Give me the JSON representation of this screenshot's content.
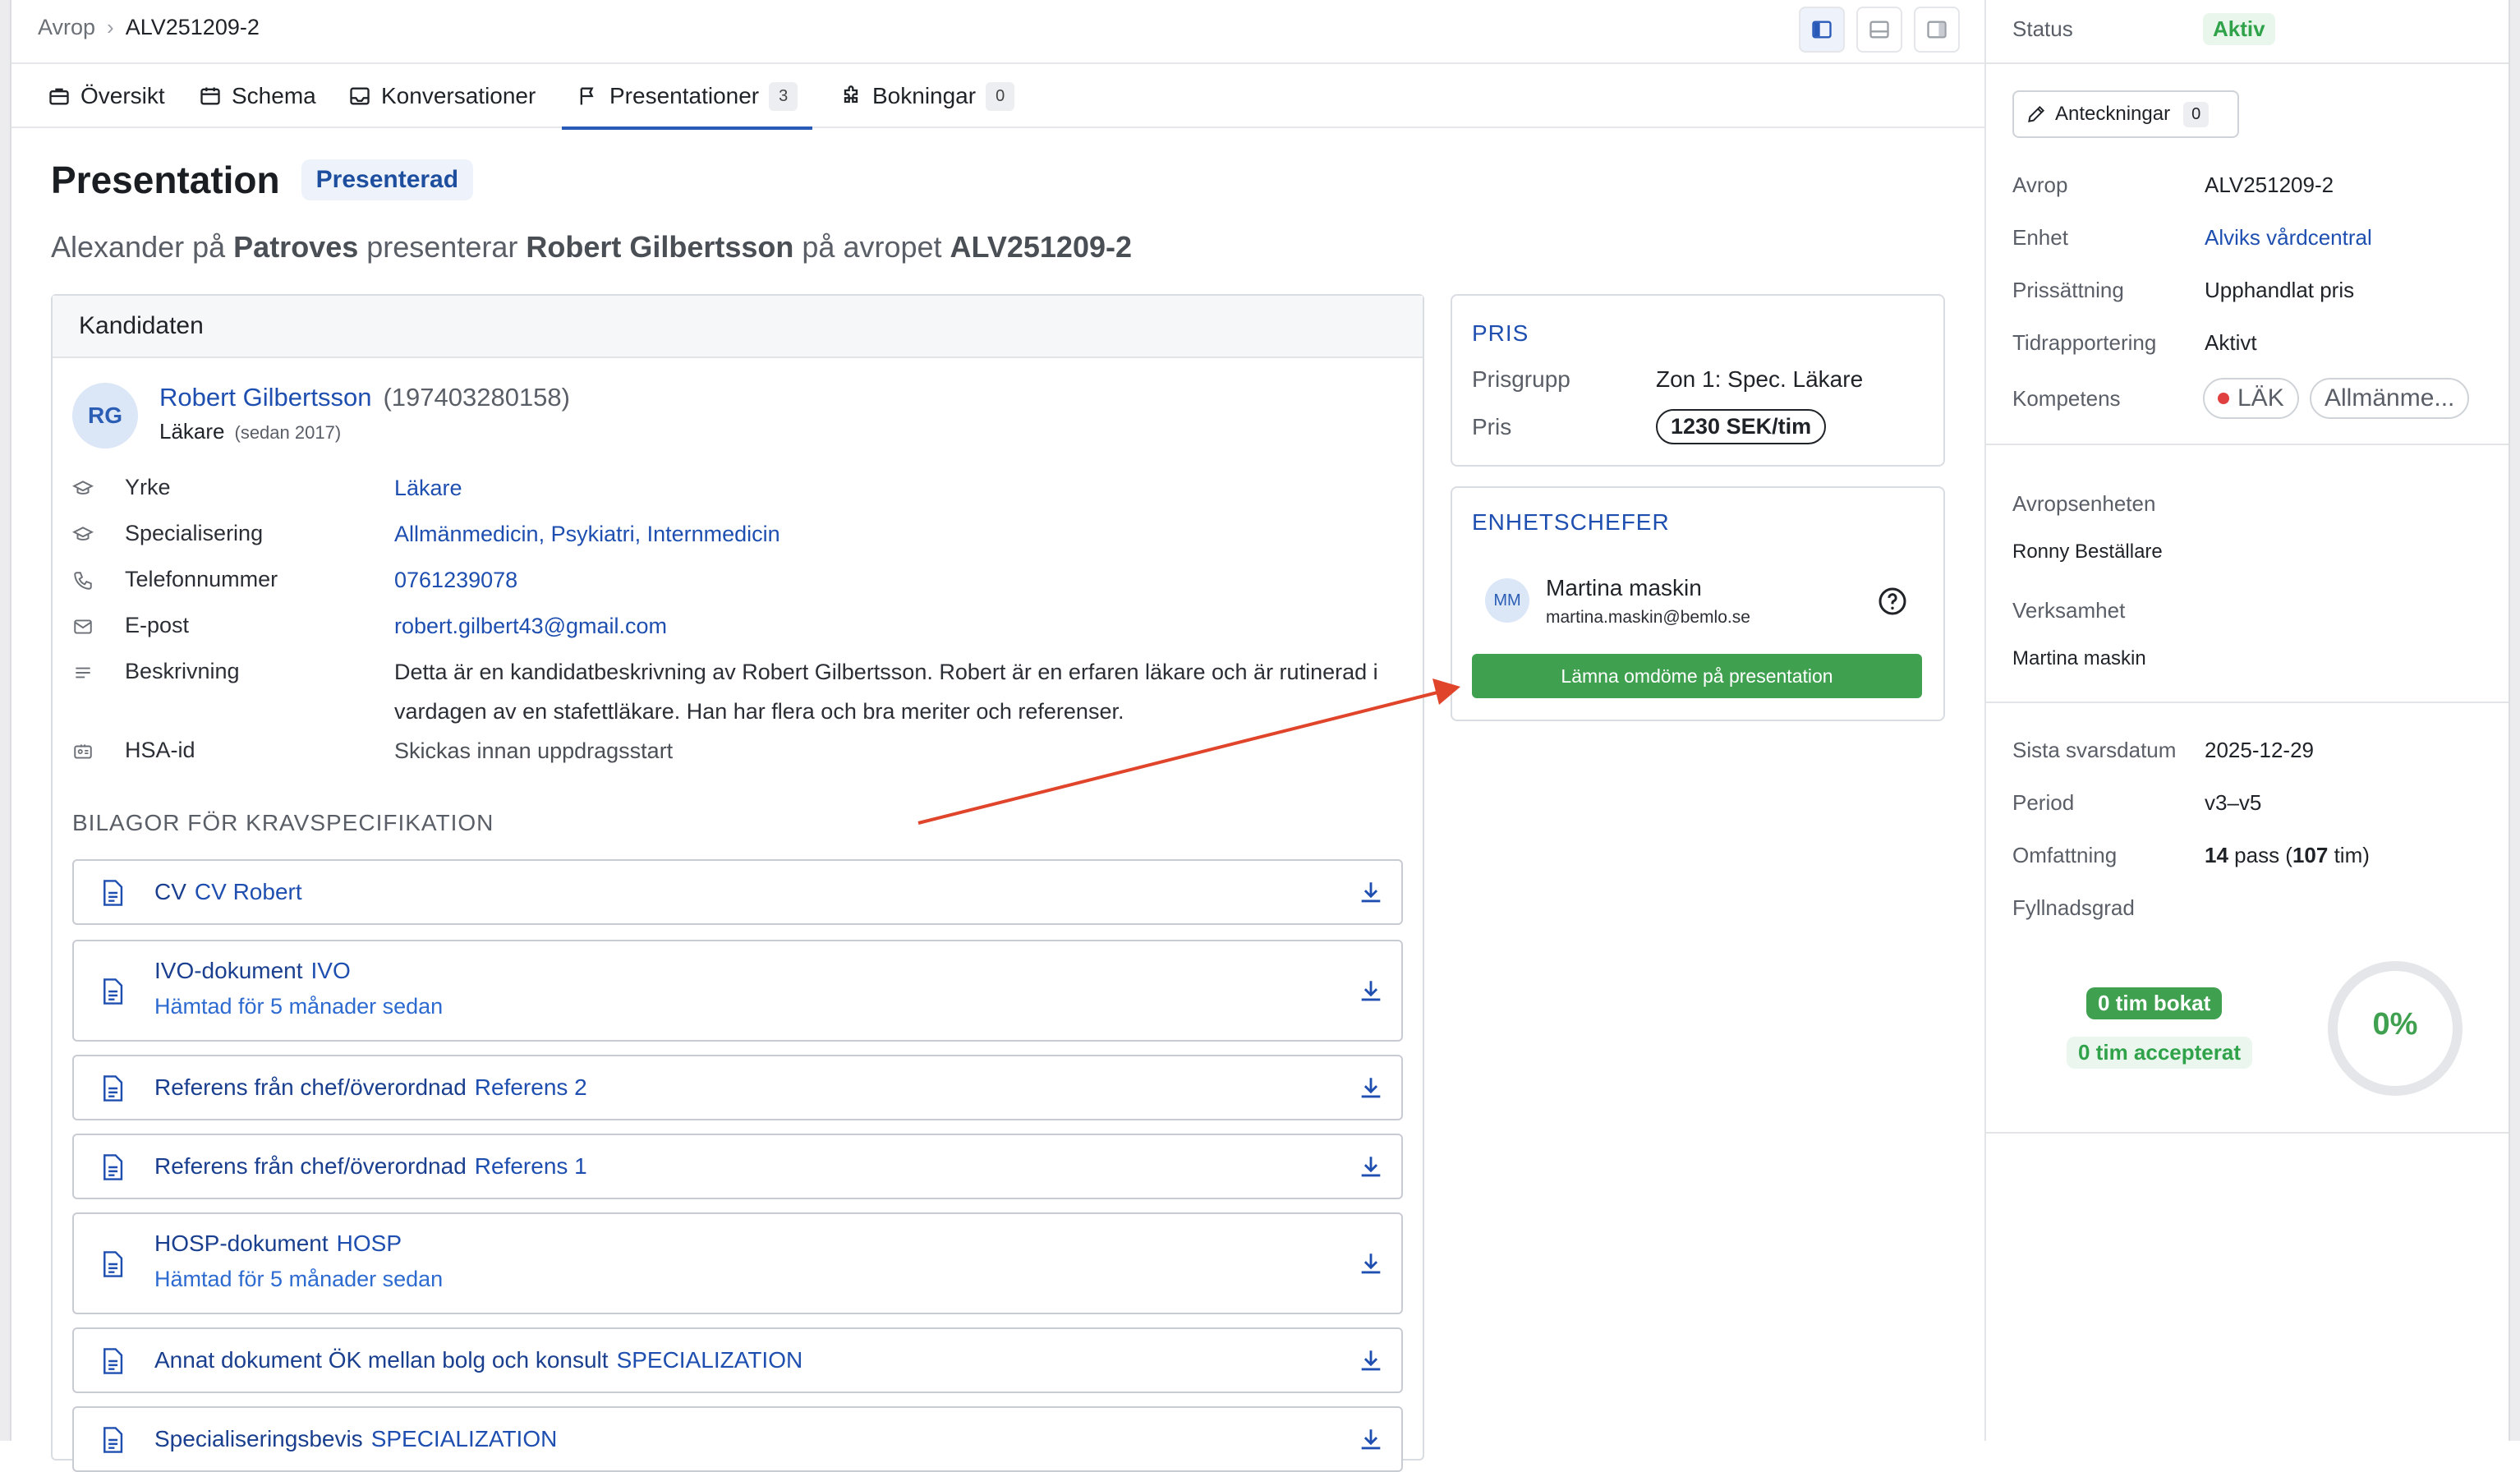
{
  "breadcrumb": {
    "root": "Avrop",
    "current": "ALV251209-2"
  },
  "tabs": [
    {
      "label": "Översikt",
      "icon": "briefcase-icon"
    },
    {
      "label": "Schema",
      "icon": "calendar-icon"
    },
    {
      "label": "Konversationer",
      "icon": "inbox-icon"
    },
    {
      "label": "Presentationer",
      "icon": "flag-icon",
      "count": "3",
      "active": true
    },
    {
      "label": "Bokningar",
      "icon": "puzzle-icon",
      "count": "0"
    }
  ],
  "header": {
    "title": "Presentation",
    "status": "Presenterad",
    "subtitle": {
      "person": "Alexander",
      "p1": " på ",
      "org": "Patroves",
      "p2": " presenterar ",
      "candidate": "Robert Gilbertsson",
      "p3": " på avropet ",
      "ref": "ALV251209-2"
    }
  },
  "candidate": {
    "section_title": "Kandidaten",
    "initials": "RG",
    "name": "Robert Gilbertsson",
    "personal_number": "(197403280158)",
    "role": "Läkare",
    "since": "(sedan 2017)",
    "fields": [
      {
        "label": "Yrke",
        "value": "Läkare",
        "icon": "graduation-cap-icon"
      },
      {
        "label": "Specialisering",
        "value": "Allmänmedicin, Psykiatri, Internmedicin",
        "icon": "graduation-cap-icon"
      },
      {
        "label": "Telefonnummer",
        "value": "0761239078",
        "icon": "phone-icon"
      },
      {
        "label": "E-post",
        "value": "robert.gilbert43@gmail.com",
        "icon": "mail-icon"
      },
      {
        "label": "Beskrivning",
        "value": "Detta är en kandidatbeskrivning av Robert Gilbertsson. Robert är en erfaren läkare och är rutinerad i vardagen av en stafettläkare. Han har flera och bra meriter och referenser.",
        "icon": "lines-icon"
      },
      {
        "label": "HSA-id",
        "value": "Skickas innan uppdragsstart",
        "icon": "id-card-icon"
      }
    ],
    "attachments_title": "BILAGOR FÖR KRAVSPECIFIKATION",
    "attachments": [
      {
        "type": "CV",
        "name": "CV Robert",
        "fetched": ""
      },
      {
        "type": "IVO-dokument",
        "name": "IVO",
        "fetched": "Hämtad för 5 månader sedan"
      },
      {
        "type": "Referens från chef/överordnad",
        "name": "Referens 2",
        "fetched": ""
      },
      {
        "type": "Referens från chef/överordnad",
        "name": "Referens 1",
        "fetched": ""
      },
      {
        "type": "HOSP-dokument",
        "name": "HOSP",
        "fetched": "Hämtad för 5 månader sedan"
      },
      {
        "type": "Annat dokument ÖK mellan bolg och konsult",
        "name": "SPECIALIZATION",
        "fetched": ""
      },
      {
        "type": "Specialiseringsbevis",
        "name": "SPECIALIZATION",
        "fetched": ""
      }
    ]
  },
  "price": {
    "title": "PRIS",
    "group_label": "Prisgrupp",
    "group_value": "Zon 1: Spec. Läkare",
    "price_label": "Pris",
    "price_value": "1230 SEK/tim"
  },
  "managers": {
    "title": "ENHETSCHEFER",
    "initials": "MM",
    "name": "Martina maskin",
    "email": "martina.maskin@bemlo.se",
    "button": "Lämna omdöme på presentation"
  },
  "sidebar": {
    "status_label": "Status",
    "status_value": "Aktiv",
    "notes_label": "Anteckningar",
    "notes_count": "0",
    "details": [
      {
        "label": "Avrop",
        "value": "ALV251209-2"
      },
      {
        "label": "Enhet",
        "value": "Alviks vårdcentral"
      },
      {
        "label": "Prissättning",
        "value": "Upphandlat pris"
      },
      {
        "label": "Tidrapportering",
        "value": "Aktivt"
      }
    ],
    "competence_label": "Kompetens",
    "competence_chips": [
      "LÄK",
      "Allmänme..."
    ],
    "unit_label": "Avropsenheten",
    "unit_value": "Ronny Beställare",
    "business_label": "Verksamhet",
    "business_value": "Martina maskin",
    "deadline_label": "Sista svarsdatum",
    "deadline_value": "2025-12-29",
    "period_label": "Period",
    "period_value": "v3–v5",
    "scope_label": "Omfattning",
    "scope_shifts": "14",
    "scope_shifts_unit": " pass (",
    "scope_hours": "107",
    "scope_hours_unit": " tim)",
    "fill_label": "Fyllnadsgrad",
    "booked": "0 tim bokat",
    "accepted": "0 tim accepterat",
    "fill_percent": "0%",
    "fill_fraction": 0
  },
  "colors": {
    "accent": "#1e4fb0",
    "success": "#3fa14f",
    "arrow": "#e0452b"
  }
}
